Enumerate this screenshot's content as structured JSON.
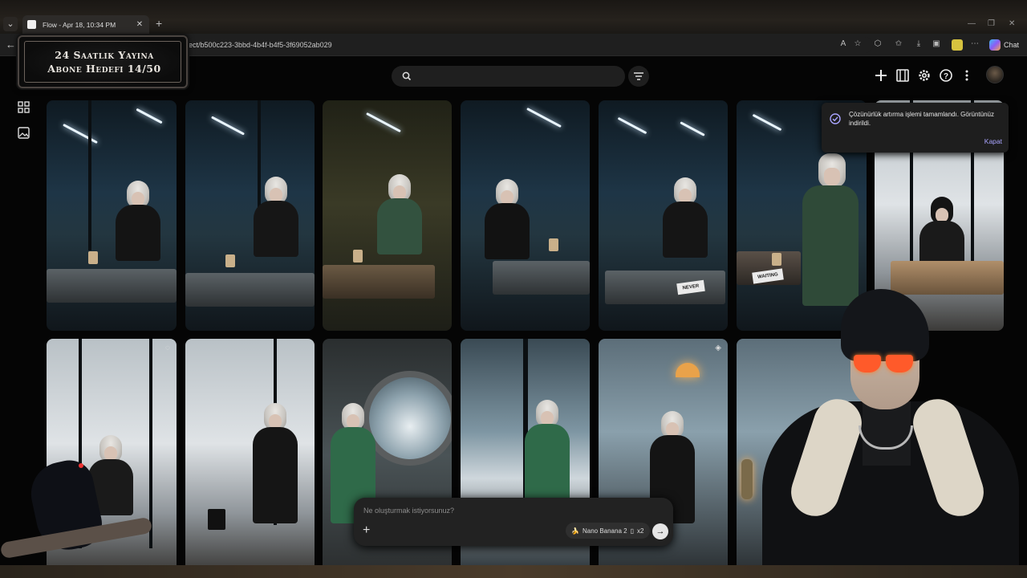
{
  "browser": {
    "tab_title": "Flow - Apr 18, 10:34 PM",
    "url": "oject/b500c223-3bbd-4b4f-b4f5-3f69052ab029",
    "chat_label": "Chat"
  },
  "overlay": {
    "banner_line1": "24 Saatlik Yayına",
    "banner_line2": "Abone Hedefi 14/50"
  },
  "search": {
    "placeholder": ""
  },
  "tiles": [
    {
      "note": ""
    },
    {
      "note": ""
    },
    {
      "note": ""
    },
    {
      "note": ""
    },
    {
      "note": "NEVER"
    },
    {
      "note": "WAITING"
    }
  ],
  "toast": {
    "message": "Çözünürlük artırma işlemi tamamlandı. Görüntünüz indirildi.",
    "action": "Kapat"
  },
  "composer": {
    "placeholder": "Ne oluşturmak istiyorsunuz?",
    "model": "Nano Banana 2",
    "count": "x2"
  },
  "colors": {
    "background": "#050505",
    "toast_action": "#a9a4ff",
    "composer": "#222222"
  }
}
